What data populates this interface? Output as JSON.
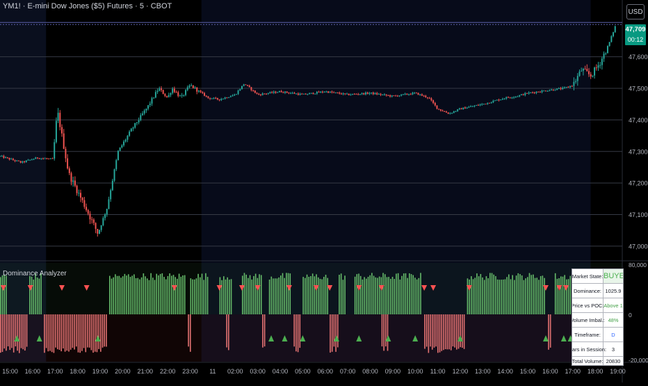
{
  "header": {
    "symbol_title": "YM1! · E-mini Dow Jones ($5) Futures · 5 · CBOT",
    "currency_button": "USD",
    "last_price": "47,709",
    "countdown": "00:12"
  },
  "indicator": {
    "title": "Dominance Analyzer",
    "table": [
      {
        "key": "Market State:",
        "value": "BUYERS"
      },
      {
        "key": "Dominance:",
        "value": "1025.9"
      },
      {
        "key": "Price vs POC:",
        "value": "Above 1"
      },
      {
        "key": "Volume Imbal.:",
        "value": "48%"
      },
      {
        "key": "Timeframe:",
        "value": "D"
      },
      {
        "key": "Bars in Session:",
        "value": "3"
      },
      {
        "key": "Total Volume:",
        "value": "20830"
      }
    ]
  },
  "colors": {
    "up": "#26a69a",
    "down": "#ef5350",
    "buyers_text": "#4caf50",
    "table_value_green": "#43a047",
    "table_value_blue": "#2962ff",
    "buy_histogram": "#66bb6a",
    "sell_histogram": "#e57373",
    "price_badge": "#089981"
  },
  "chart_data": {
    "type": "candlestick",
    "price_axis": {
      "ticks": [
        47000,
        47100,
        47200,
        47300,
        47400,
        47500,
        47600,
        47709
      ],
      "tick_labels": [
        "47,000",
        "47,100",
        "47,200",
        "47,300",
        "47,400",
        "47,500",
        "47,600",
        "47,709"
      ],
      "ylim": [
        46960,
        47780
      ]
    },
    "time_axis": {
      "tick_labels": [
        "15:00",
        "16:00",
        "17:00",
        "18:00",
        "19:00",
        "20:00",
        "21:00",
        "22:00",
        "23:00",
        "11",
        "02:00",
        "03:00",
        "04:00",
        "05:00",
        "06:00",
        "07:00",
        "08:00",
        "09:00",
        "10:00",
        "11:00",
        "12:00",
        "13:00",
        "14:00",
        "15:00",
        "16:00",
        "17:00",
        "18:00",
        "19:00"
      ],
      "hours_from_start": [
        0,
        1,
        2,
        3,
        4,
        5,
        6,
        7,
        8,
        9,
        10,
        11,
        12,
        13,
        14,
        15,
        16,
        17,
        18,
        19,
        20,
        21,
        22,
        23,
        24,
        25,
        26,
        27
      ],
      "xlim_hours": [
        -0.45,
        27.2
      ]
    },
    "price_path_hours": [
      -0.45,
      0.5,
      1.2,
      1.9,
      2.1,
      2.6,
      3.3,
      3.9,
      4.3,
      4.8,
      5.4,
      6.1,
      6.6,
      7.0,
      7.2,
      7.6,
      8.0,
      8.3,
      8.8,
      9.3,
      10.0,
      10.4,
      11.0,
      12.0,
      13.0,
      14.0,
      15.0,
      16.0,
      17.0,
      18.0,
      18.6,
      19.0,
      19.5,
      20.0,
      21.0,
      22.0,
      22.5,
      23.0,
      23.5,
      24.0,
      24.6,
      25.0,
      25.4,
      25.8,
      26.2,
      26.6,
      26.95
    ],
    "price_path_values": [
      47285,
      47265,
      47280,
      47275,
      47430,
      47230,
      47130,
      47040,
      47120,
      47300,
      47370,
      47440,
      47500,
      47470,
      47500,
      47470,
      47510,
      47495,
      47470,
      47465,
      47480,
      47515,
      47480,
      47490,
      47480,
      47490,
      47480,
      47485,
      47475,
      47485,
      47470,
      47435,
      47420,
      47435,
      47450,
      47470,
      47475,
      47485,
      47490,
      47495,
      47500,
      47510,
      47560,
      47540,
      47580,
      47640,
      47709
    ],
    "indicator_axis": {
      "tick_labels": [
        "80,000",
        "0",
        "-20,000"
      ],
      "ticks": [
        80000,
        0,
        -20000
      ]
    },
    "indicator_buy_segments_hours": [
      [
        -0.45,
        -0.1
      ],
      [
        0.85,
        1.4
      ],
      [
        4.4,
        7.8
      ],
      [
        8.0,
        8.8
      ],
      [
        9.3,
        9.9
      ],
      [
        10.3,
        11.2
      ],
      [
        11.5,
        12.5
      ],
      [
        13.0,
        14.2
      ],
      [
        14.6,
        14.9
      ],
      [
        15.3,
        18.3
      ],
      [
        20.3,
        23.8
      ],
      [
        24.2,
        25.2
      ]
    ],
    "indicator_sell_segments_hours": [
      [
        -0.45,
        0.8
      ],
      [
        1.5,
        4.3
      ],
      [
        7.9,
        8.1
      ],
      [
        9.6,
        9.8
      ],
      [
        11.2,
        11.4
      ],
      [
        12.6,
        12.9
      ],
      [
        14.2,
        14.6
      ],
      [
        16.5,
        16.8
      ],
      [
        18.4,
        20.2
      ],
      [
        23.9,
        24.1
      ],
      [
        25.0,
        25.3
      ]
    ],
    "sell_signal_hours": [
      -0.3,
      0.9,
      2.3,
      3.4,
      7.3,
      9.3,
      10.3,
      11.0,
      12.4,
      13.6,
      14.2,
      15.5,
      16.5,
      18.4,
      18.8,
      20.4,
      23.8,
      24.4,
      24.7
    ],
    "buy_signal_hours": [
      0.3,
      1.3,
      3.9,
      11.6,
      12.2,
      13.0,
      14.5,
      15.5,
      16.8,
      18.0,
      20.0,
      23.8,
      24.6,
      24.9
    ]
  }
}
